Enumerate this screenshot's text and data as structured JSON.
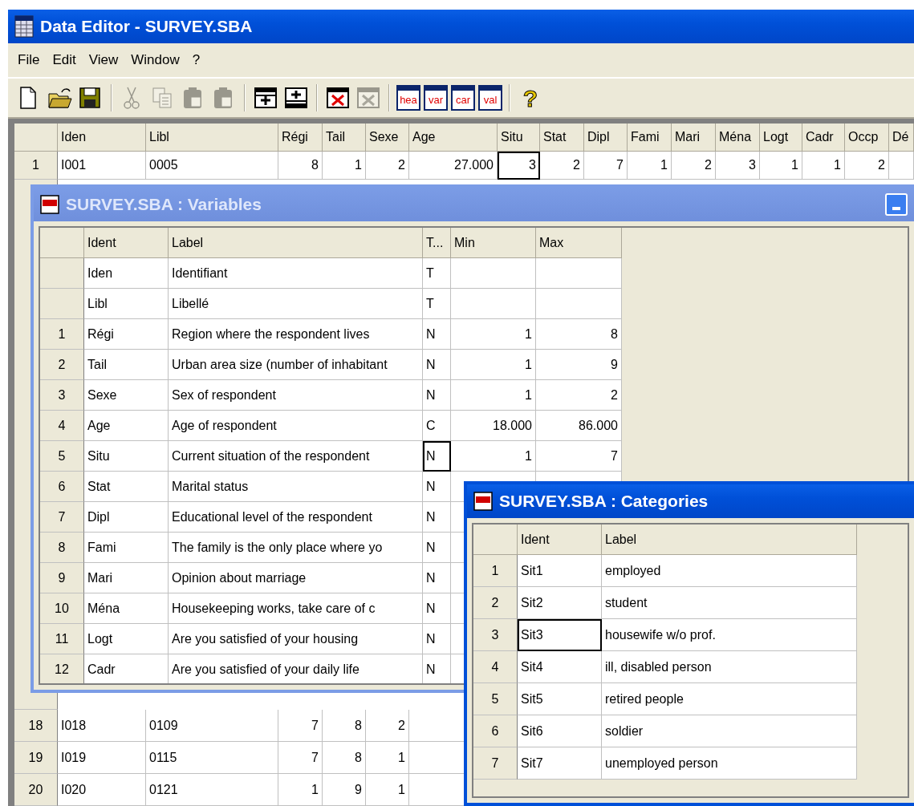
{
  "window": {
    "title": "Data Editor - SURVEY.SBA",
    "active": true
  },
  "menu": [
    {
      "label": "File"
    },
    {
      "label": "Edit"
    },
    {
      "label": "View"
    },
    {
      "label": "Window"
    },
    {
      "label": "?"
    }
  ],
  "toolbar": [
    {
      "kind": "new",
      "disabled": false
    },
    {
      "kind": "open",
      "disabled": false
    },
    {
      "kind": "save",
      "disabled": false
    },
    {
      "kind": "separator"
    },
    {
      "kind": "cut",
      "disabled": true
    },
    {
      "kind": "copy",
      "disabled": true
    },
    {
      "kind": "paste",
      "disabled": true
    },
    {
      "kind": "paste",
      "disabled": true
    },
    {
      "kind": "separator"
    },
    {
      "kind": "insert-row",
      "disabled": false
    },
    {
      "kind": "insert-column",
      "disabled": false
    },
    {
      "kind": "separator"
    },
    {
      "kind": "delete",
      "disabled": false
    },
    {
      "kind": "delete",
      "disabled": true
    },
    {
      "kind": "separator"
    },
    {
      "kind": "text",
      "label": "hea",
      "disabled": false
    },
    {
      "kind": "text",
      "label": "var",
      "disabled": false
    },
    {
      "kind": "text",
      "label": "car",
      "disabled": false
    },
    {
      "kind": "text",
      "label": "val",
      "disabled": false
    },
    {
      "kind": "separator"
    },
    {
      "kind": "help",
      "label": "?",
      "disabled": false
    }
  ],
  "data_grid": {
    "columns": [
      "Iden",
      "Libl",
      "Régi",
      "Tail",
      "Sexe",
      "Age",
      "Situ",
      "Stat",
      "Dipl",
      "Fami",
      "Mari",
      "Ména",
      "Logt",
      "Cadr",
      "Occp",
      "Dé"
    ],
    "top_rows": [
      {
        "number": "1",
        "cells": [
          {
            "text": "I001",
            "selected": false
          },
          {
            "text": "0005",
            "selected": false
          },
          {
            "text": "8",
            "selected": false
          },
          {
            "text": "1",
            "selected": false
          },
          {
            "text": "2",
            "selected": false
          },
          {
            "text": "27.000",
            "selected": false
          },
          {
            "text": "3",
            "selected": true
          },
          {
            "text": "2",
            "selected": false
          },
          {
            "text": "7",
            "selected": false
          },
          {
            "text": "1",
            "selected": false
          },
          {
            "text": "2",
            "selected": false
          },
          {
            "text": "3",
            "selected": false
          },
          {
            "text": "1",
            "selected": false
          },
          {
            "text": "1",
            "selected": false
          },
          {
            "text": "2",
            "selected": false
          }
        ]
      }
    ],
    "bottom_rows": [
      {
        "number": "18",
        "cells": [
          {
            "text": "I018",
            "selected": false
          },
          {
            "text": "0109",
            "selected": false
          },
          {
            "text": "7",
            "selected": false
          },
          {
            "text": "8",
            "selected": false
          },
          {
            "text": "2",
            "selected": false
          }
        ]
      },
      {
        "number": "19",
        "cells": [
          {
            "text": "I019",
            "selected": false
          },
          {
            "text": "0115",
            "selected": false
          },
          {
            "text": "7",
            "selected": false
          },
          {
            "text": "8",
            "selected": false
          },
          {
            "text": "1",
            "selected": false
          }
        ]
      },
      {
        "number": "20",
        "cells": [
          {
            "text": "I020",
            "selected": false
          },
          {
            "text": "0121",
            "selected": false
          },
          {
            "text": "1",
            "selected": false
          },
          {
            "text": "9",
            "selected": false
          },
          {
            "text": "1",
            "selected": false
          }
        ]
      }
    ]
  },
  "variables_window": {
    "title": "SURVEY.SBA : Variables",
    "active": false,
    "columns": [
      "Ident",
      "Label",
      "T...",
      "Min",
      "Max"
    ],
    "rows": [
      {
        "number": "",
        "cells": [
          {
            "text": "Iden",
            "selected": false
          },
          {
            "text": "Identifiant",
            "selected": false
          },
          {
            "text": "T",
            "selected": false
          },
          {
            "text": "",
            "selected": false
          },
          {
            "text": "",
            "selected": false
          }
        ]
      },
      {
        "number": "",
        "cells": [
          {
            "text": "Libl",
            "selected": false
          },
          {
            "text": "Libellé",
            "selected": false
          },
          {
            "text": "T",
            "selected": false
          },
          {
            "text": "",
            "selected": false
          },
          {
            "text": "",
            "selected": false
          }
        ]
      },
      {
        "number": "1",
        "cells": [
          {
            "text": "Régi",
            "selected": false
          },
          {
            "text": "Region where the respondent lives",
            "selected": false
          },
          {
            "text": "N",
            "selected": false
          },
          {
            "text": "1",
            "selected": false
          },
          {
            "text": "8",
            "selected": false
          }
        ]
      },
      {
        "number": "2",
        "cells": [
          {
            "text": "Tail",
            "selected": false
          },
          {
            "text": "Urban area size (number of inhabitant",
            "selected": false
          },
          {
            "text": "N",
            "selected": false
          },
          {
            "text": "1",
            "selected": false
          },
          {
            "text": "9",
            "selected": false
          }
        ]
      },
      {
        "number": "3",
        "cells": [
          {
            "text": "Sexe",
            "selected": false
          },
          {
            "text": "Sex of respondent",
            "selected": false
          },
          {
            "text": "N",
            "selected": false
          },
          {
            "text": "1",
            "selected": false
          },
          {
            "text": "2",
            "selected": false
          }
        ]
      },
      {
        "number": "4",
        "cells": [
          {
            "text": "Age",
            "selected": false
          },
          {
            "text": "Age of respondent",
            "selected": false
          },
          {
            "text": "C",
            "selected": false
          },
          {
            "text": "18.000",
            "selected": false
          },
          {
            "text": "86.000",
            "selected": false
          }
        ]
      },
      {
        "number": "5",
        "cells": [
          {
            "text": "Situ",
            "selected": false
          },
          {
            "text": "Current situation of the respondent",
            "selected": false
          },
          {
            "text": "N",
            "selected": true
          },
          {
            "text": "1",
            "selected": false
          },
          {
            "text": "7",
            "selected": false
          }
        ]
      },
      {
        "number": "6",
        "cells": [
          {
            "text": "Stat",
            "selected": false
          },
          {
            "text": "Marital status",
            "selected": false
          },
          {
            "text": "N",
            "selected": false
          }
        ]
      },
      {
        "number": "7",
        "cells": [
          {
            "text": "Dipl",
            "selected": false
          },
          {
            "text": "Educational level of the respondent",
            "selected": false
          },
          {
            "text": "N",
            "selected": false
          }
        ]
      },
      {
        "number": "8",
        "cells": [
          {
            "text": "Fami",
            "selected": false
          },
          {
            "text": "The family is the only place where yo",
            "selected": false
          },
          {
            "text": "N",
            "selected": false
          }
        ]
      },
      {
        "number": "9",
        "cells": [
          {
            "text": "Mari",
            "selected": false
          },
          {
            "text": "Opinion about marriage",
            "selected": false
          },
          {
            "text": "N",
            "selected": false
          }
        ]
      },
      {
        "number": "10",
        "cells": [
          {
            "text": "Ména",
            "selected": false
          },
          {
            "text": "Housekeeping works, take care of c",
            "selected": false
          },
          {
            "text": "N",
            "selected": false
          }
        ]
      },
      {
        "number": "11",
        "cells": [
          {
            "text": "Logt",
            "selected": false
          },
          {
            "text": "Are you satisfied of your housing",
            "selected": false
          },
          {
            "text": "N",
            "selected": false
          }
        ]
      },
      {
        "number": "12",
        "cells": [
          {
            "text": "Cadr",
            "selected": false
          },
          {
            "text": "Are you satisfied of your daily life",
            "selected": false
          },
          {
            "text": "N",
            "selected": false
          }
        ]
      }
    ]
  },
  "categories_window": {
    "title": "SURVEY.SBA : Categories",
    "active": true,
    "columns": [
      "Ident",
      "Label"
    ],
    "rows": [
      {
        "number": "1",
        "cells": [
          {
            "text": "Sit1",
            "selected": false
          },
          {
            "text": "employed",
            "selected": false
          }
        ]
      },
      {
        "number": "2",
        "cells": [
          {
            "text": "Sit2",
            "selected": false
          },
          {
            "text": "student",
            "selected": false
          }
        ]
      },
      {
        "number": "3",
        "cells": [
          {
            "text": "Sit3",
            "selected": true
          },
          {
            "text": "housewife w/o prof.",
            "selected": false
          }
        ]
      },
      {
        "number": "4",
        "cells": [
          {
            "text": "Sit4",
            "selected": false
          },
          {
            "text": "ill, disabled person",
            "selected": false
          }
        ]
      },
      {
        "number": "5",
        "cells": [
          {
            "text": "Sit5",
            "selected": false
          },
          {
            "text": "retired people",
            "selected": false
          }
        ]
      },
      {
        "number": "6",
        "cells": [
          {
            "text": "Sit6",
            "selected": false
          },
          {
            "text": "soldier",
            "selected": false
          }
        ]
      },
      {
        "number": "7",
        "cells": [
          {
            "text": "Sit7",
            "selected": false
          },
          {
            "text": "unemployed person",
            "selected": false
          }
        ]
      }
    ]
  }
}
